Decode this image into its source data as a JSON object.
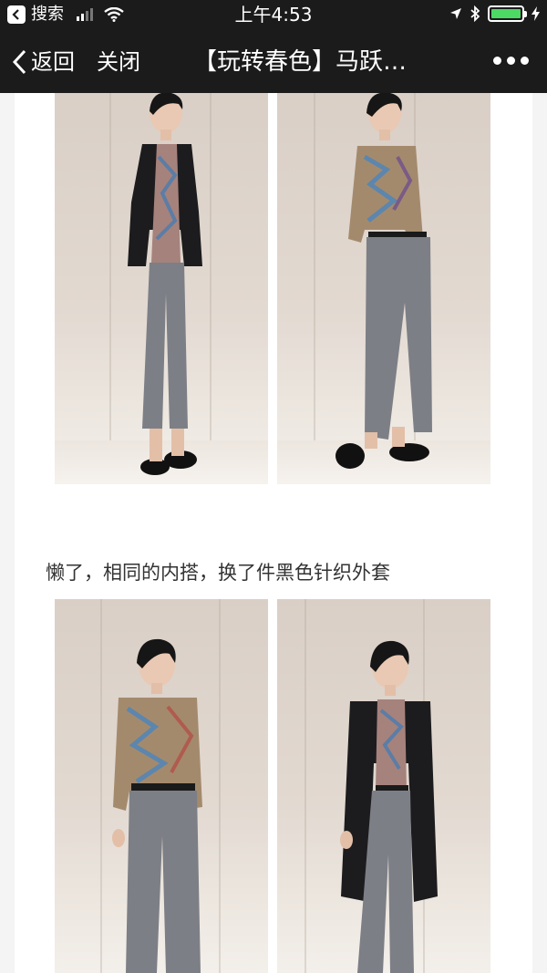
{
  "status_bar": {
    "back_app": "搜索",
    "time": "上午4:53"
  },
  "nav": {
    "back_label": "返回",
    "close_label": "关闭",
    "title": "【玩转春色】马跃…"
  },
  "article": {
    "caption": "懒了，相同的内搭，换了件黑色针织外套"
  },
  "colors": {
    "bar_bg": "#1b1b1b",
    "battery": "#4cd964",
    "backdrop": "#ddd3ca",
    "pants": "#7d7f86",
    "jacket": "#1c1c1e"
  }
}
